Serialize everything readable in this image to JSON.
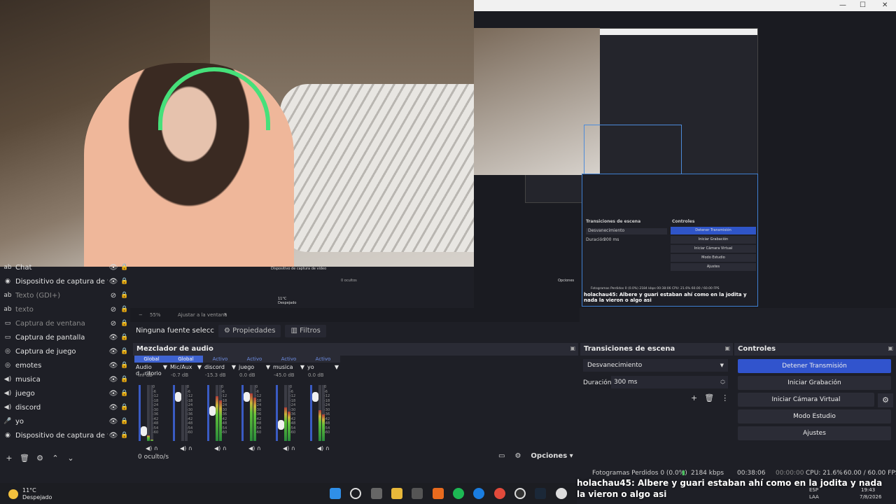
{
  "nested": {
    "scene_transitions_title": "Transiciones de escena",
    "controls_title": "Controles",
    "transition": "Desvanecimiento",
    "duration_label": "Duración",
    "duration": "300 ms",
    "buttons": [
      "Detener Transmisión",
      "Iniciar Grabación",
      "Iniciar Cámara Virtual",
      "Modo Estudio",
      "Ajustes"
    ],
    "chat_user": "holachau45",
    "chat_text": ": Albere y guari estaban ahí como en la jodita y nada la vieron o algo asi",
    "status": "Fotogramas Perdidos 0 (0.0%)   2184 kbps   00:38:06   CPU: 21.6%   60.00 / 60.00 FPS",
    "mini_sources": "Dispositivo de captura de video",
    "mini_hidden": "0 ocultos",
    "mini_options": "Opciones",
    "mini_weather_temp": "11°C",
    "mini_weather": "Despejado",
    "zoom": "55%",
    "fit": "Ajustar a la ventana"
  },
  "sources": [
    {
      "label": "Chat",
      "icon": "text-icon",
      "dim": false
    },
    {
      "label": "Dispositivo de captura de video",
      "icon": "camera-icon",
      "dim": false
    },
    {
      "label": "Texto (GDI+)",
      "icon": "text-icon",
      "dim": true
    },
    {
      "label": "texto",
      "icon": "text-icon",
      "dim": true
    },
    {
      "label": "Captura de ventana",
      "icon": "window-icon",
      "dim": true
    },
    {
      "label": "Captura de pantalla",
      "icon": "monitor-icon",
      "dim": false
    },
    {
      "label": "Captura de juego",
      "icon": "gamepad-icon",
      "dim": false
    },
    {
      "label": "emotes",
      "icon": "gamepad-icon",
      "dim": false
    },
    {
      "label": "musica",
      "icon": "speaker-icon",
      "dim": false
    },
    {
      "label": "juego",
      "icon": "speaker-icon",
      "dim": false
    },
    {
      "label": "discord",
      "icon": "speaker-icon",
      "dim": false
    },
    {
      "label": "yo",
      "icon": "mic-icon",
      "dim": false
    },
    {
      "label": "Dispositivo de captura de video",
      "icon": "camera-icon",
      "dim": false
    }
  ],
  "toolbar": {
    "no_source": "Ninguna fuente seleccionada",
    "properties": "Propiedades",
    "filters": "Filtros"
  },
  "mixer": {
    "title": "Mezclador de audio",
    "channels": [
      {
        "state": "Global",
        "name": "Audio d...ritorio",
        "db": "-inf dB",
        "level": 0.1,
        "fader": 0.1
      },
      {
        "state": "Global",
        "name": "Mic/Aux",
        "db": "-0.7 dB",
        "level": 0.0,
        "fader": 0.85
      },
      {
        "state": "Activo",
        "name": "discord",
        "db": "-15.3 dB",
        "level": 0.8,
        "fader": 0.55
      },
      {
        "state": "Activo",
        "name": "juego",
        "db": "0.0 dB",
        "level": 0.85,
        "fader": 0.85
      },
      {
        "state": "Activo",
        "name": "musica",
        "db": "-45.0 dB",
        "level": 0.6,
        "fader": 0.25
      },
      {
        "state": "Activo",
        "name": "yo",
        "db": "0.0 dB",
        "level": 0.55,
        "fader": 0.85
      }
    ],
    "scale": [
      "0",
      "-6",
      "-12",
      "-18",
      "-24",
      "-30",
      "-36",
      "-42",
      "-48",
      "-54",
      "-60"
    ],
    "hidden": "0 oculto/s",
    "options": "Opciones"
  },
  "transitions": {
    "title": "Transiciones de escena",
    "selected": "Desvanecimiento",
    "duration_label": "Duración",
    "duration": "300 ms"
  },
  "controls": {
    "title": "Controles",
    "stop_stream": "Detener Transmisión",
    "start_recording": "Iniciar Grabación",
    "virtual_cam": "Iniciar Cámara Virtual",
    "studio_mode": "Modo Estudio",
    "settings": "Ajustes"
  },
  "statusbar": {
    "dropped": "Fotogramas Perdidos 0 (0.0%)",
    "bitrate": "2184 kbps",
    "live_time": "00:38:06",
    "rec_time": "00:00:00",
    "cpu": "CPU: 21.6%",
    "fps": "60.00 / 60.00 FPS"
  },
  "chat": {
    "user": "holachau45",
    "message": ": Albere y guari estaban ahí como en la jodita y nada la vieron o algo asi"
  },
  "taskbar": {
    "temp": "11°C",
    "weather": "Despejado",
    "lang1": "ESP",
    "lang2": "LAA",
    "time": "19:43",
    "date": "7/8/2026"
  },
  "colors": {
    "accent_blue": "#3154cd",
    "headset_green": "#46e07a"
  }
}
